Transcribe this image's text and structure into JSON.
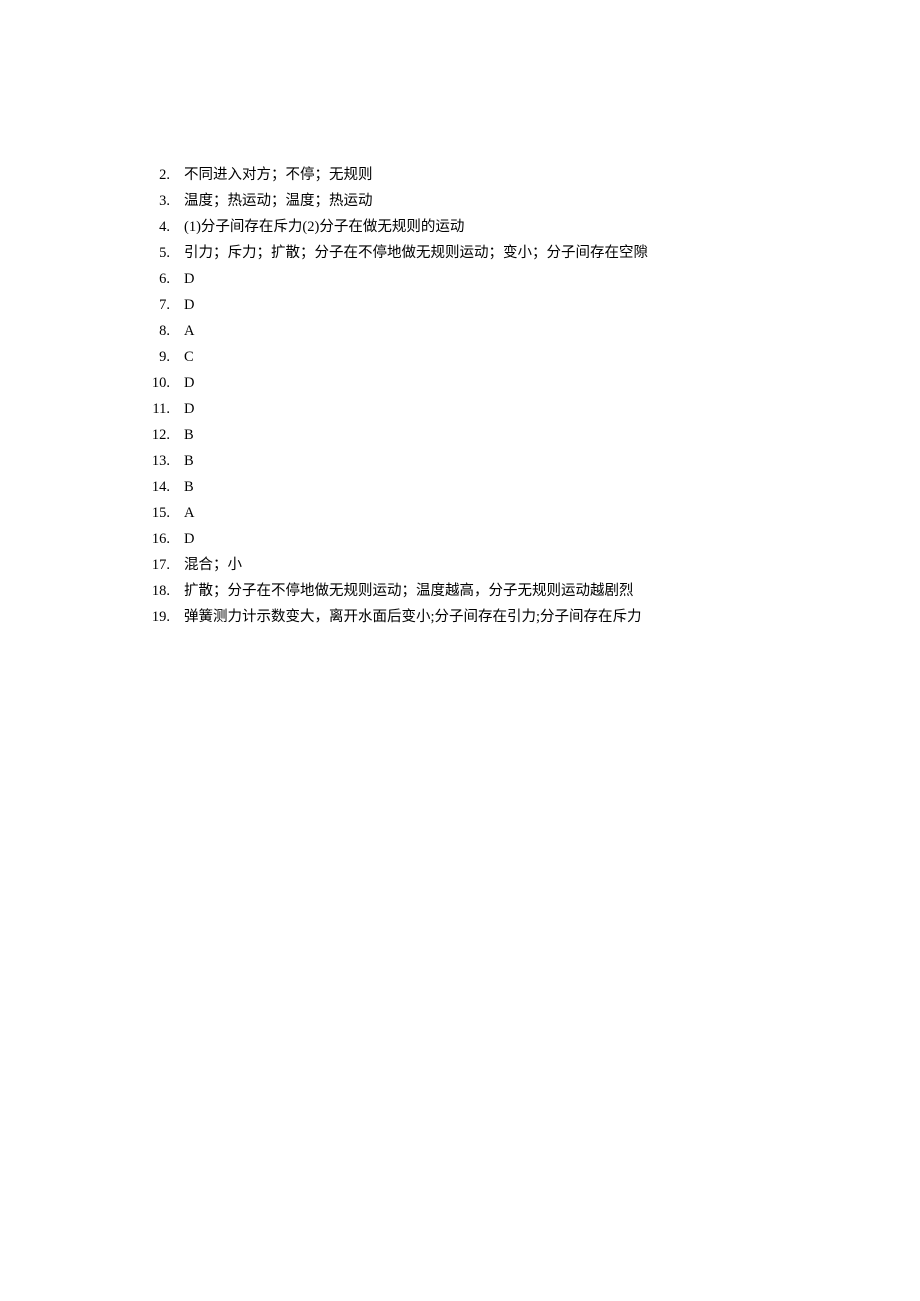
{
  "answers": [
    {
      "num": "2.",
      "text": "不同进入对方；不停；无规则"
    },
    {
      "num": "3.",
      "text": "温度；热运动；温度；热运动"
    },
    {
      "num": "4.",
      "text": "(1)分子间存在斥力(2)分子在做无规则的运动"
    },
    {
      "num": "5.",
      "text": "引力；斥力；扩散；分子在不停地做无规则运动；变小；分子间存在空隙"
    },
    {
      "num": "6.",
      "text": "D"
    },
    {
      "num": "7.",
      "text": "D"
    },
    {
      "num": "8.",
      "text": "A"
    },
    {
      "num": "9.",
      "text": "C"
    },
    {
      "num": "10.",
      "text": "D"
    },
    {
      "num": "11.",
      "text": "D"
    },
    {
      "num": "12.",
      "text": "B"
    },
    {
      "num": "13.",
      "text": "B"
    },
    {
      "num": "14.",
      "text": "B"
    },
    {
      "num": "15.",
      "text": "A"
    },
    {
      "num": "16.",
      "text": "D"
    },
    {
      "num": "17.",
      "text": "混合；小"
    },
    {
      "num": "18.",
      "text": "扩散；分子在不停地做无规则运动；温度越高，分子无规则运动越剧烈"
    },
    {
      "num": "19.",
      "text": "弹簧测力计示数变大，离开水面后变小;分子间存在引力;分子间存在斥力"
    }
  ]
}
